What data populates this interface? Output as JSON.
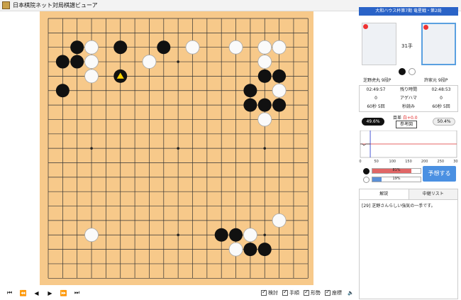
{
  "window": {
    "title": "日本棋院ネット対局棋譜ビューア"
  },
  "board": {
    "size": 19,
    "stars": [
      [
        3,
        3
      ],
      [
        3,
        9
      ],
      [
        3,
        15
      ],
      [
        9,
        3
      ],
      [
        9,
        9
      ],
      [
        9,
        15
      ],
      [
        15,
        3
      ],
      [
        15,
        9
      ],
      [
        15,
        15
      ]
    ],
    "black": [
      [
        2,
        2
      ],
      [
        2,
        3
      ],
      [
        5,
        2
      ],
      [
        8,
        2
      ],
      [
        15,
        4
      ],
      [
        1,
        5
      ],
      [
        1,
        3
      ],
      [
        14,
        5
      ],
      [
        14,
        6
      ],
      [
        16,
        4
      ],
      [
        16,
        6
      ],
      [
        15,
        6
      ],
      [
        12,
        15
      ],
      [
        14,
        16
      ],
      [
        15,
        16
      ],
      [
        13,
        15
      ]
    ],
    "white": [
      [
        3,
        2
      ],
      [
        3,
        3
      ],
      [
        3,
        4
      ],
      [
        7,
        3
      ],
      [
        10,
        2
      ],
      [
        13,
        2
      ],
      [
        15,
        2
      ],
      [
        16,
        2
      ],
      [
        15,
        3
      ],
      [
        16,
        5
      ],
      [
        15,
        7
      ],
      [
        16,
        14
      ],
      [
        14,
        15
      ],
      [
        13,
        16
      ],
      [
        3,
        15
      ]
    ],
    "last_move": [
      5,
      4
    ]
  },
  "controls": {
    "nav": [
      "⏮",
      "⏪",
      "◀",
      "▶",
      "⏩",
      "⏭"
    ],
    "options": [
      {
        "label": "検討",
        "checked": true
      },
      {
        "label": "手順",
        "checked": true
      },
      {
        "label": "形勢",
        "checked": true
      },
      {
        "label": "座標",
        "checked": true
      }
    ],
    "volume": "🔈"
  },
  "right": {
    "event": "大和ハウス杯第7期 竜星戦・第2局",
    "move_number": "31手",
    "black_name": "芝野虎丸 9段P",
    "white_name": "許家元 9段P",
    "time": {
      "header": [
        "02:49:57",
        "残り時間",
        "02:48:53"
      ],
      "captures": [
        "0",
        "アゲハマ",
        "0"
      ],
      "byoyomi": [
        "60秒 5回",
        "秒読み",
        "60秒 5回"
      ]
    },
    "black_rate": "49.6%",
    "white_rate": "50.4%",
    "diff_label": "目差",
    "diff_value": "白+0.0",
    "ref_button": "参考図",
    "graph": {
      "xticks": [
        "0",
        "50",
        "100",
        "150",
        "200",
        "250",
        "300"
      ],
      "current_move": 31
    },
    "predict": {
      "black": "81%",
      "white": "19%",
      "black_fill": 0.81,
      "white_fill": 0.19
    },
    "predict_button": "予想する",
    "tabs": [
      "解説",
      "中継リスト"
    ],
    "comment": "[29] 芝野さんらしい強気の一手です。"
  }
}
